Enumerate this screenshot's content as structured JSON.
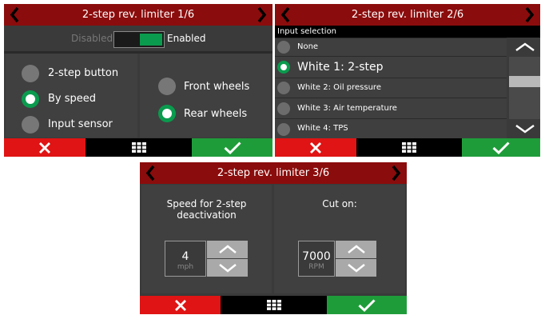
{
  "screen1": {
    "title": "2-step rev. limiter 1/6",
    "toggle": {
      "off_label": "Disabled",
      "on_label": "Enabled",
      "state": "enabled"
    },
    "mode_options": [
      {
        "label": "2-step button",
        "selected": false
      },
      {
        "label": "By speed",
        "selected": true
      },
      {
        "label": "Input sensor",
        "selected": false
      }
    ],
    "wheel_options": [
      {
        "label": "Front wheels",
        "selected": false
      },
      {
        "label": "Rear wheels",
        "selected": true
      }
    ]
  },
  "screen2": {
    "title": "2-step rev. limiter 2/6",
    "section_label": "Input selection",
    "items": [
      {
        "label": "None",
        "selected": false
      },
      {
        "label": "White 1: 2-step",
        "selected": true
      },
      {
        "label": "White 2: Oil pressure",
        "selected": false
      },
      {
        "label": "White 3: Air temperature",
        "selected": false
      },
      {
        "label": "White 4: TPS",
        "selected": false
      }
    ]
  },
  "screen3": {
    "title": "2-step rev. limiter 3/6",
    "speed": {
      "label": "Speed for 2-step deactivation",
      "value": "4",
      "unit": "mph"
    },
    "cut": {
      "label": "Cut on:",
      "value": "7000",
      "unit": "RPM"
    }
  },
  "icons": {
    "prev": "chevron-left-icon",
    "next": "chevron-right-icon",
    "cancel": "x-icon",
    "menu": "grid-icon",
    "confirm": "checkmark-icon",
    "up": "chevron-up-icon",
    "down": "chevron-down-icon"
  },
  "colors": {
    "title_bar": "#8b0c0c",
    "cancel": "#e01414",
    "confirm": "#1f9c3a",
    "selected": "#0a9b4e",
    "panel": "#404040"
  }
}
